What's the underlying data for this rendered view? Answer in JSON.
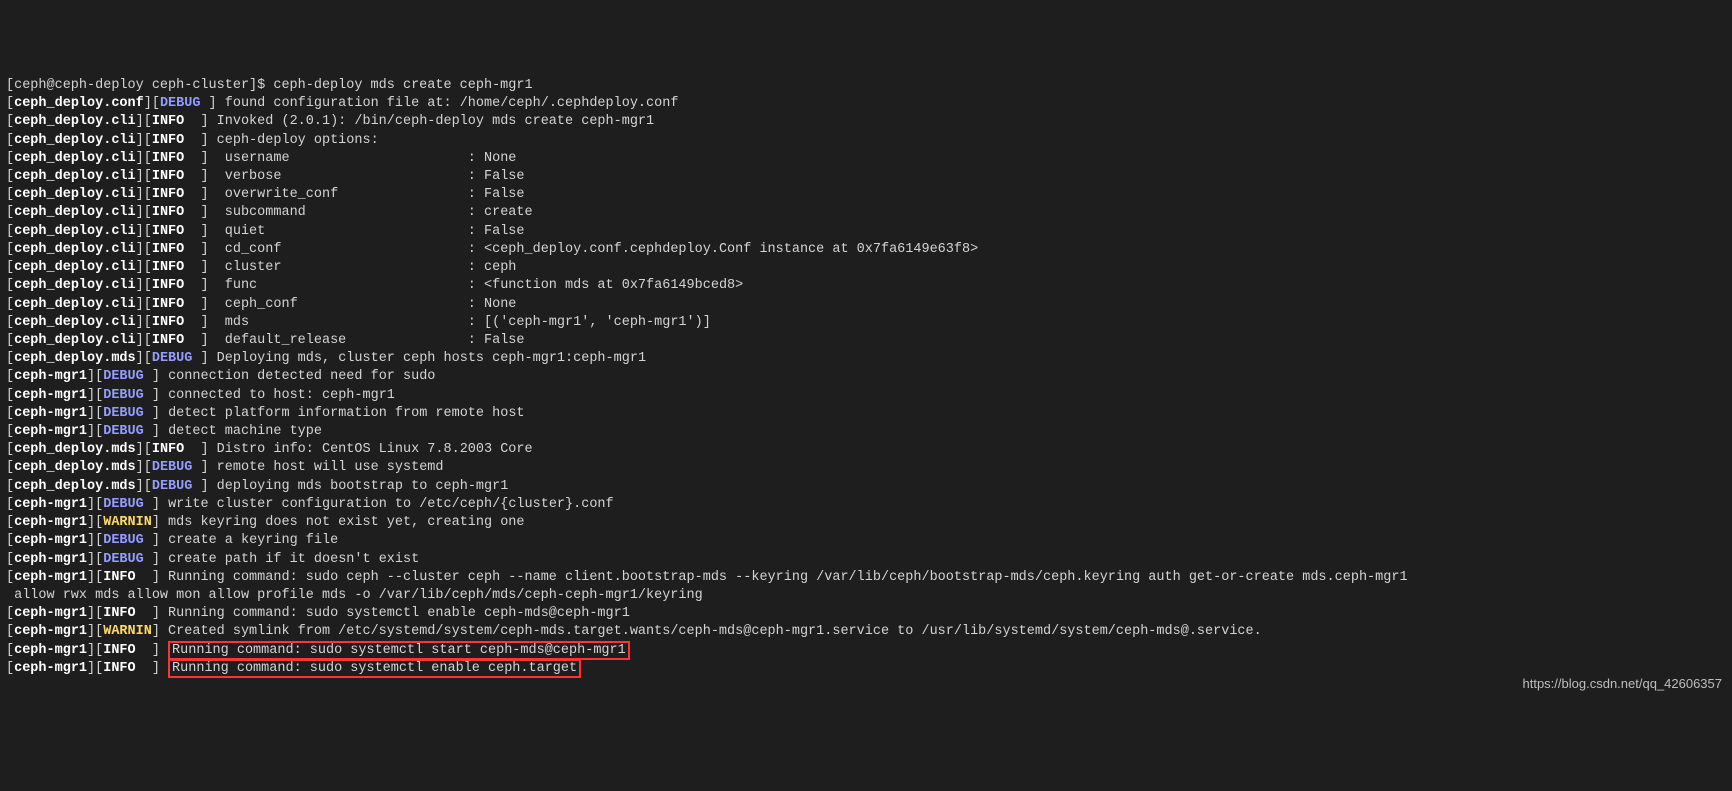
{
  "prompt": "[ceph@ceph-deploy ceph-cluster]$ ceph-deploy mds create ceph-mgr1",
  "watermark": "https://blog.csdn.net/qq_42606357",
  "lines": [
    {
      "src": "ceph_deploy.conf",
      "lvl": "DEBUG",
      "pad": 1,
      "msg": "found configuration file at: /home/ceph/.cephdeploy.conf"
    },
    {
      "src": "ceph_deploy.cli",
      "lvl": "INFO",
      "pad": 2,
      "msg": "Invoked (2.0.1): /bin/ceph-deploy mds create ceph-mgr1"
    },
    {
      "src": "ceph_deploy.cli",
      "lvl": "INFO",
      "pad": 2,
      "msg": "ceph-deploy options:"
    },
    {
      "src": "ceph_deploy.cli",
      "lvl": "INFO",
      "pad": 2,
      "key": "username",
      "val": "None"
    },
    {
      "src": "ceph_deploy.cli",
      "lvl": "INFO",
      "pad": 2,
      "key": "verbose",
      "val": "False"
    },
    {
      "src": "ceph_deploy.cli",
      "lvl": "INFO",
      "pad": 2,
      "key": "overwrite_conf",
      "val": "False"
    },
    {
      "src": "ceph_deploy.cli",
      "lvl": "INFO",
      "pad": 2,
      "key": "subcommand",
      "val": "create"
    },
    {
      "src": "ceph_deploy.cli",
      "lvl": "INFO",
      "pad": 2,
      "key": "quiet",
      "val": "False"
    },
    {
      "src": "ceph_deploy.cli",
      "lvl": "INFO",
      "pad": 2,
      "key": "cd_conf",
      "val": "<ceph_deploy.conf.cephdeploy.Conf instance at 0x7fa6149e63f8>"
    },
    {
      "src": "ceph_deploy.cli",
      "lvl": "INFO",
      "pad": 2,
      "key": "cluster",
      "val": "ceph"
    },
    {
      "src": "ceph_deploy.cli",
      "lvl": "INFO",
      "pad": 2,
      "key": "func",
      "val": "<function mds at 0x7fa6149bced8>"
    },
    {
      "src": "ceph_deploy.cli",
      "lvl": "INFO",
      "pad": 2,
      "key": "ceph_conf",
      "val": "None"
    },
    {
      "src": "ceph_deploy.cli",
      "lvl": "INFO",
      "pad": 2,
      "key": "mds",
      "val": "[('ceph-mgr1', 'ceph-mgr1')]"
    },
    {
      "src": "ceph_deploy.cli",
      "lvl": "INFO",
      "pad": 2,
      "key": "default_release",
      "val": "False"
    },
    {
      "src": "ceph_deploy.mds",
      "lvl": "DEBUG",
      "pad": 1,
      "msg": "Deploying mds, cluster ceph hosts ceph-mgr1:ceph-mgr1"
    },
    {
      "src": "ceph-mgr1",
      "lvl": "DEBUG",
      "pad": 1,
      "msg": "connection detected need for sudo"
    },
    {
      "src": "ceph-mgr1",
      "lvl": "DEBUG",
      "pad": 1,
      "msg": "connected to host: ceph-mgr1"
    },
    {
      "src": "ceph-mgr1",
      "lvl": "DEBUG",
      "pad": 1,
      "msg": "detect platform information from remote host"
    },
    {
      "src": "ceph-mgr1",
      "lvl": "DEBUG",
      "pad": 1,
      "msg": "detect machine type"
    },
    {
      "src": "ceph_deploy.mds",
      "lvl": "INFO",
      "pad": 2,
      "msg": "Distro info: CentOS Linux 7.8.2003 Core"
    },
    {
      "src": "ceph_deploy.mds",
      "lvl": "DEBUG",
      "pad": 1,
      "msg": "remote host will use systemd"
    },
    {
      "src": "ceph_deploy.mds",
      "lvl": "DEBUG",
      "pad": 1,
      "msg": "deploying mds bootstrap to ceph-mgr1"
    },
    {
      "src": "ceph-mgr1",
      "lvl": "DEBUG",
      "pad": 1,
      "msg": "write cluster configuration to /etc/ceph/{cluster}.conf"
    },
    {
      "src": "ceph-mgr1",
      "lvl": "WARNIN",
      "pad": 0,
      "msg": "mds keyring does not exist yet, creating one"
    },
    {
      "src": "ceph-mgr1",
      "lvl": "DEBUG",
      "pad": 1,
      "msg": "create a keyring file"
    },
    {
      "src": "ceph-mgr1",
      "lvl": "DEBUG",
      "pad": 1,
      "msg": "create path if it doesn't exist"
    },
    {
      "src": "ceph-mgr1",
      "lvl": "INFO",
      "pad": 2,
      "msg": "Running command: sudo ceph --cluster ceph --name client.bootstrap-mds --keyring /var/lib/ceph/bootstrap-mds/ceph.keyring auth get-or-create mds.ceph-mgr1",
      "tail": " allow rwx mds allow mon allow profile mds -o /var/lib/ceph/mds/ceph-ceph-mgr1/keyring"
    },
    {
      "src": "ceph-mgr1",
      "lvl": "INFO",
      "pad": 2,
      "msg": "Running command: sudo systemctl enable ceph-mds@ceph-mgr1"
    },
    {
      "src": "ceph-mgr1",
      "lvl": "WARNIN",
      "pad": 0,
      "msg": "Created symlink from /etc/systemd/system/ceph-mds.target.wants/ceph-mds@ceph-mgr1.service to /usr/lib/systemd/system/ceph-mds@.service."
    },
    {
      "src": "ceph-mgr1",
      "lvl": "INFO",
      "pad": 2,
      "msg": "Running command: sudo systemctl start ceph-mds@ceph-mgr1",
      "hl": true
    },
    {
      "src": "ceph-mgr1",
      "lvl": "INFO",
      "pad": 2,
      "msg": "Running command: sudo systemctl enable ceph.target",
      "hl": true
    }
  ]
}
